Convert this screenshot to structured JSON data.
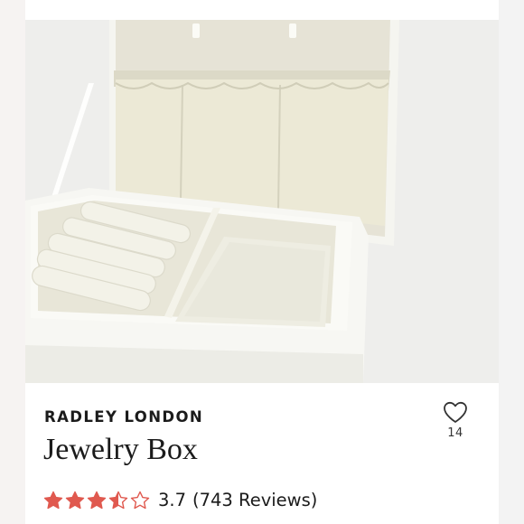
{
  "listing": {
    "brand": "RADLEY LONDON",
    "title": "Jewelry Box",
    "likes": "14",
    "rating": {
      "value": "3.7",
      "stars": 3.5,
      "max_stars": 5,
      "reviews_text": "(743 Reviews)",
      "star_color": "#e0594f"
    },
    "image": {
      "subject": "cream jewelry box with open lid, ring rolls and pouch compartment"
    }
  },
  "icons": {
    "like": "heart-outline-icon",
    "star": "star-icon"
  }
}
